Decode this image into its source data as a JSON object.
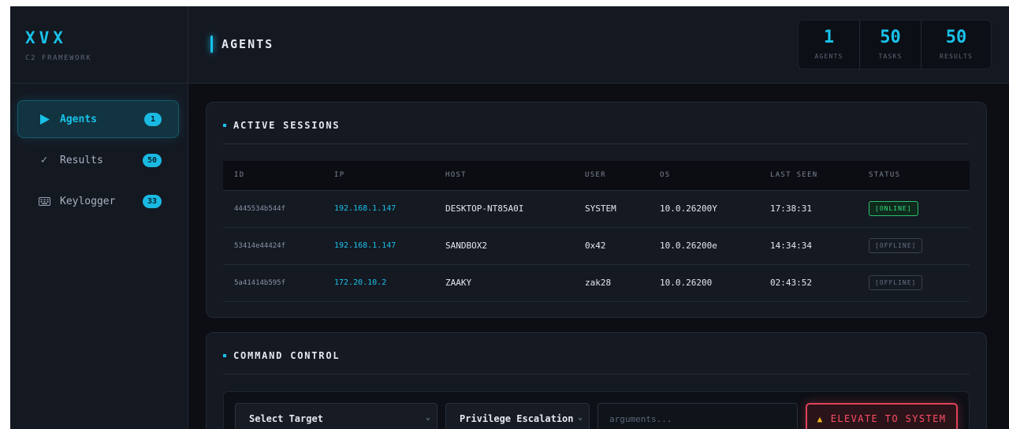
{
  "brand": {
    "title": "XVX",
    "subtitle": "C2 FRAMEWORK"
  },
  "nav": [
    {
      "icon": "play-icon",
      "label": "Agents",
      "badge": "1",
      "active": true
    },
    {
      "icon": "check-icon",
      "label": "Results",
      "badge": "50"
    },
    {
      "icon": "keyboard-icon",
      "label": "Keylogger",
      "badge": "33"
    }
  ],
  "header": {
    "title": "AGENTS",
    "stats": [
      {
        "value": "1",
        "label": "AGENTS"
      },
      {
        "value": "50",
        "label": "TASKS"
      },
      {
        "value": "50",
        "label": "RESULTS"
      }
    ]
  },
  "sessions": {
    "title": "ACTIVE SESSIONS",
    "columns": [
      "ID",
      "IP",
      "HOST",
      "USER",
      "OS",
      "LAST SEEN",
      "STATUS"
    ],
    "rows": [
      {
        "id": "4445534b544f",
        "ip": "192.168.1.147",
        "host": "DESKTOP-NT85A0I",
        "user": "SYSTEM",
        "os": "10.0.26200Y",
        "last_seen": "17:38:31",
        "status": "[ONLINE]"
      },
      {
        "id": "53414e44424f",
        "ip": "192.168.1.147",
        "host": "SANDBOX2",
        "user": "0x42",
        "os": "10.0.26200e",
        "last_seen": "14:34:34",
        "status": "[OFFLINE]"
      },
      {
        "id": "5a41414b595f",
        "ip": "172.20.10.2",
        "host": "ZAAKY",
        "user": "zak28",
        "os": "10.0.26200",
        "last_seen": "02:43:52",
        "status": "[OFFLINE]"
      }
    ]
  },
  "command": {
    "title": "COMMAND CONTROL",
    "target_select": "Select Target",
    "module_select": "Privilege Escalation",
    "args_placeholder": "arguments...",
    "action_label": "ELEVATE TO SYSTEM"
  },
  "colors": {
    "accent": "#19c2ea",
    "online": "#2fe27e",
    "danger": "#e0425a"
  }
}
